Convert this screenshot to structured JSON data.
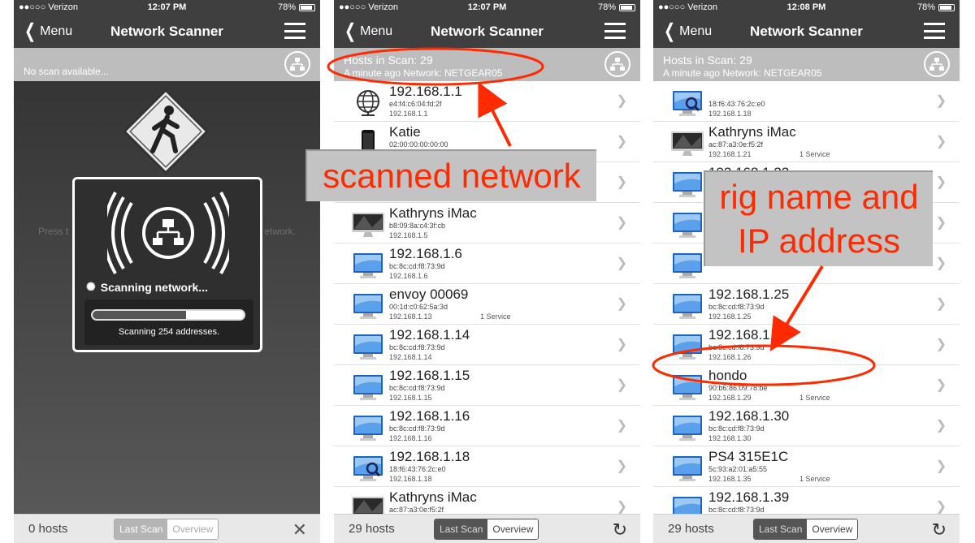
{
  "status": [
    {
      "carrier": "●●○○○ Verizon",
      "time": "12:07 PM",
      "battery": "78%"
    },
    {
      "carrier": "●●○○○ Verizon",
      "time": "12:07 PM",
      "battery": "78%"
    },
    {
      "carrier": "●●○○○ Verizon",
      "time": "12:08 PM",
      "battery": "78%"
    }
  ],
  "nav": {
    "back_label": "Menu",
    "title": "Network Scanner"
  },
  "screen1": {
    "subbar_text": "No scan available...",
    "press_left": "Press t",
    "press_right": "etwork.",
    "hud_message": "Scanning network...",
    "hud_progress_text": "Scanning 254 addresses.",
    "progress_fraction": 0.62,
    "hosts": "0 hosts",
    "seg": [
      "Last Scan",
      "Overview"
    ]
  },
  "screen2": {
    "subbar_line1": "Hosts in Scan: 29",
    "subbar_line2": "A minute ago  Network: NETGEAR05",
    "rows": [
      {
        "name": "192.168.1.1",
        "mac": "e4:f4:c6:04:fd:2f",
        "ip": "192.168.1.1",
        "svc": "",
        "icon": "globe-icon"
      },
      {
        "name": "Katie",
        "mac": "02:00:00:00:00:00",
        "ip": "",
        "svc": "",
        "icon": "phone-icon"
      },
      {
        "name": "",
        "mac": "",
        "ip": "",
        "svc": "",
        "icon": "monitor-icon"
      },
      {
        "name": "Kathryns iMac",
        "mac": "b8:09:8a:c4:3f:cb",
        "ip": "192.168.1.5",
        "svc": "",
        "icon": "imac-icon"
      },
      {
        "name": "192.168.1.6",
        "mac": "bc:8c:cd:f8:73:9d",
        "ip": "192.168.1.6",
        "svc": "",
        "icon": "monitor-icon"
      },
      {
        "name": "envoy 00069",
        "mac": "00:1d:c0:62:5a:3d",
        "ip": "192.168.1.13",
        "svc": "1 Service",
        "icon": "monitor-icon"
      },
      {
        "name": "192.168.1.14",
        "mac": "bc:8c:cd:f8:73:9d",
        "ip": "192.168.1.14",
        "svc": "",
        "icon": "monitor-icon"
      },
      {
        "name": "192.168.1.15",
        "mac": "bc:8c:cd:f8:73:9d",
        "ip": "192.168.1.15",
        "svc": "",
        "icon": "monitor-icon"
      },
      {
        "name": "192.168.1.16",
        "mac": "bc:8c:cd:f8:73:9d",
        "ip": "192.168.1.16",
        "svc": "",
        "icon": "monitor-icon"
      },
      {
        "name": "192.168.1.18",
        "mac": "18:f6:43:76:2c:e0",
        "ip": "192.168.1.18",
        "svc": "",
        "icon": "monitor-search-icon"
      },
      {
        "name": "Kathryns iMac",
        "mac": "ac:87:a3:0e:f5:2f",
        "ip": "",
        "svc": "",
        "icon": "imac-icon"
      }
    ],
    "hosts": "29 hosts",
    "seg": [
      "Last Scan",
      "Overview"
    ]
  },
  "screen3": {
    "subbar_line1": "Hosts in Scan: 29",
    "subbar_line2": "A minute ago  Network: NETGEAR05",
    "rows": [
      {
        "name": "",
        "mac": "18:f6:43:76:2c:e0",
        "ip": "192.168.1.18",
        "svc": "",
        "icon": "monitor-search-icon"
      },
      {
        "name": "Kathryns iMac",
        "mac": "ac:87:a3:0e:f5:2f",
        "ip": "192.168.1.21",
        "svc": "1 Service",
        "icon": "imac-icon"
      },
      {
        "name": "192.168.1.22",
        "mac": "bc:8c:cd:f8:73:9d",
        "ip": "",
        "svc": "",
        "icon": "monitor-icon"
      },
      {
        "name": "",
        "mac": "",
        "ip": "",
        "svc": "",
        "icon": "monitor-icon"
      },
      {
        "name": "",
        "mac": "",
        "ip": "",
        "svc": "",
        "icon": "monitor-icon"
      },
      {
        "name": "192.168.1.25",
        "mac": "bc:8c:cd:f8:73:9d",
        "ip": "192.168.1.25",
        "svc": "",
        "icon": "monitor-icon"
      },
      {
        "name": "192.168.1.26",
        "mac": "bc:8c:cd:f8:73:9d",
        "ip": "192.168.1.26",
        "svc": "",
        "icon": "monitor-icon"
      },
      {
        "name": "hondo",
        "mac": "90:b6:86:09:78:be",
        "ip": "192.168.1.29",
        "svc": "1 Service",
        "icon": "monitor-icon"
      },
      {
        "name": "192.168.1.30",
        "mac": "bc:8c:cd:f8:73:9d",
        "ip": "192.168.1.30",
        "svc": "",
        "icon": "monitor-icon"
      },
      {
        "name": "PS4 315E1C",
        "mac": "5c:93:a2:01:a5:55",
        "ip": "192.168.1.35",
        "svc": "1 Service",
        "icon": "monitor-icon"
      },
      {
        "name": "192.168.1.39",
        "mac": "bc:8c:cd:f8:73:9d",
        "ip": "192.168.1.39",
        "svc": "",
        "icon": "monitor-icon"
      }
    ],
    "hosts": "29 hosts",
    "seg": [
      "Last Scan",
      "Overview"
    ]
  },
  "annotations": {
    "scanned": "scanned network",
    "rig_line1": "rig name and",
    "rig_line2": "IP address",
    "color": "#ff2a00"
  }
}
